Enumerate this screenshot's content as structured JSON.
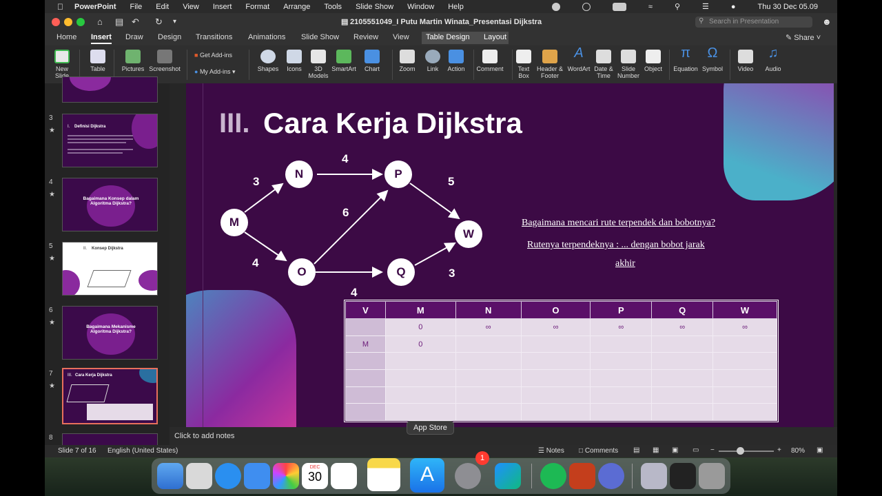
{
  "menubar": {
    "app": "PowerPoint",
    "items": [
      "File",
      "Edit",
      "View",
      "Insert",
      "Format",
      "Arrange",
      "Tools",
      "Slide Show",
      "Window",
      "Help"
    ],
    "clock": "Thu 30 Dec  05.09"
  },
  "window": {
    "title": "2105551049_I Putu Martin Winata_Presentasi Dijkstra"
  },
  "search": {
    "placeholder": "Search in Presentation"
  },
  "share_label": "Share",
  "tabs": [
    "Home",
    "Insert",
    "Draw",
    "Design",
    "Transitions",
    "Animations",
    "Slide Show",
    "Review",
    "View",
    "Table Design",
    "Layout"
  ],
  "ribbon": {
    "new_slide": "New Slide",
    "table": "Table",
    "pictures": "Pictures",
    "screenshot": "Screenshot",
    "get_addins": "Get Add-ins",
    "my_addins": "My Add-ins",
    "shapes": "Shapes",
    "icons": "Icons",
    "models": "3D Models",
    "smartart": "SmartArt",
    "chart": "Chart",
    "zoom": "Zoom",
    "link": "Link",
    "action": "Action",
    "comment": "Comment",
    "textbox": "Text Box",
    "header_footer": "Header & Footer",
    "wordart": "WordArt",
    "date_time": "Date & Time",
    "slide_number": "Slide Number",
    "object": "Object",
    "equation": "Equation",
    "symbol": "Symbol",
    "video": "Video",
    "audio": "Audio"
  },
  "thumbs": [
    {
      "num": "3",
      "title": "Definisi Dijkstra",
      "title_num": "I."
    },
    {
      "num": "4",
      "title": "Bagaimana Konsep dalam Algoritma Dijkstra?"
    },
    {
      "num": "5",
      "title": "Konsep Dijkstra",
      "title_num": "II."
    },
    {
      "num": "6",
      "title": "Bagaimana Mekanisme Algoritma Dijkstra?"
    },
    {
      "num": "7",
      "title": "Cara Kerja Dijkstra",
      "title_num": "III."
    },
    {
      "num": "8"
    }
  ],
  "slide": {
    "title_num": "III.",
    "title": "Cara Kerja Dijkstra",
    "question1": "Bagaimana mencari rute terpendek dan bobotnya?",
    "question2": "Rutenya terpendeknya : ... dengan bobot jarak",
    "question3": "akhir",
    "graph": {
      "nodes": [
        "M",
        "N",
        "O",
        "P",
        "Q",
        "W"
      ],
      "weights": {
        "MN": "3",
        "NP": "4",
        "PW": "5",
        "OP": "6",
        "MO": "4",
        "OQ": "4",
        "QW": "3"
      }
    },
    "table": {
      "headers": [
        "V",
        "M",
        "N",
        "O",
        "P",
        "Q",
        "W"
      ],
      "rows": [
        [
          "",
          "0",
          "∞",
          "∞",
          "∞",
          "∞",
          "∞"
        ],
        [
          "M",
          "0",
          "",
          "",
          "",
          "",
          ""
        ],
        [
          "",
          "",
          "",
          "",
          "",
          "",
          ""
        ],
        [
          "",
          "",
          "",
          "",
          "",
          "",
          ""
        ],
        [
          "",
          "",
          "",
          "",
          "",
          "",
          ""
        ],
        [
          "",
          "",
          "",
          "",
          "",
          "",
          ""
        ]
      ]
    }
  },
  "notes_placeholder": "Click to add notes",
  "tooltip": "App Store",
  "status": {
    "slide": "Slide 7 of 16",
    "language": "English (United States)",
    "notes": "Notes",
    "comments": "Comments",
    "zoom": "80%"
  },
  "dock": {
    "calendar_month": "DEC",
    "calendar_day": "30",
    "settings_badge": "1"
  }
}
